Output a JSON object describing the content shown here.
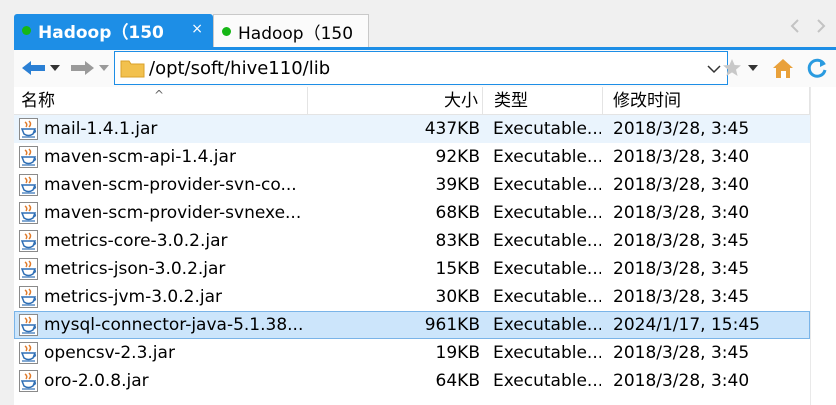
{
  "tabs": [
    {
      "label": "Hadoop（150",
      "close": "×"
    },
    {
      "label": "Hadoop（150"
    }
  ],
  "toolbar": {
    "path": "/opt/soft/hive110/lib"
  },
  "columns": {
    "name": "名称",
    "size": "大小",
    "type": "类型",
    "modified": "修改时间"
  },
  "files": [
    {
      "name": "mail-1.4.1.jar",
      "size": "437KB",
      "type": "Executable...",
      "modified": "2018/3/28, 3:45"
    },
    {
      "name": "maven-scm-api-1.4.jar",
      "size": "92KB",
      "type": "Executable...",
      "modified": "2018/3/28, 3:40"
    },
    {
      "name": "maven-scm-provider-svn-co...",
      "size": "39KB",
      "type": "Executable...",
      "modified": "2018/3/28, 3:40"
    },
    {
      "name": "maven-scm-provider-svnexe...",
      "size": "68KB",
      "type": "Executable...",
      "modified": "2018/3/28, 3:40"
    },
    {
      "name": "metrics-core-3.0.2.jar",
      "size": "83KB",
      "type": "Executable...",
      "modified": "2018/3/28, 3:45"
    },
    {
      "name": "metrics-json-3.0.2.jar",
      "size": "15KB",
      "type": "Executable...",
      "modified": "2018/3/28, 3:45"
    },
    {
      "name": "metrics-jvm-3.0.2.jar",
      "size": "30KB",
      "type": "Executable...",
      "modified": "2018/3/28, 3:45"
    },
    {
      "name": "mysql-connector-java-5.1.38...",
      "size": "961KB",
      "type": "Executable...",
      "modified": "2024/1/17, 15:45"
    },
    {
      "name": "opencsv-2.3.jar",
      "size": "19KB",
      "type": "Executable...",
      "modified": "2018/3/28, 3:45"
    },
    {
      "name": "oro-2.0.8.jar",
      "size": "64KB",
      "type": "Executable...",
      "modified": "2018/3/28, 3:40"
    }
  ],
  "selected_index": 7,
  "highlighted_index": 0,
  "colors": {
    "accent": "#1d8ee6",
    "status_dot": "#16b716",
    "selection": "#cce5fb",
    "hover": "#eaf4fd"
  }
}
